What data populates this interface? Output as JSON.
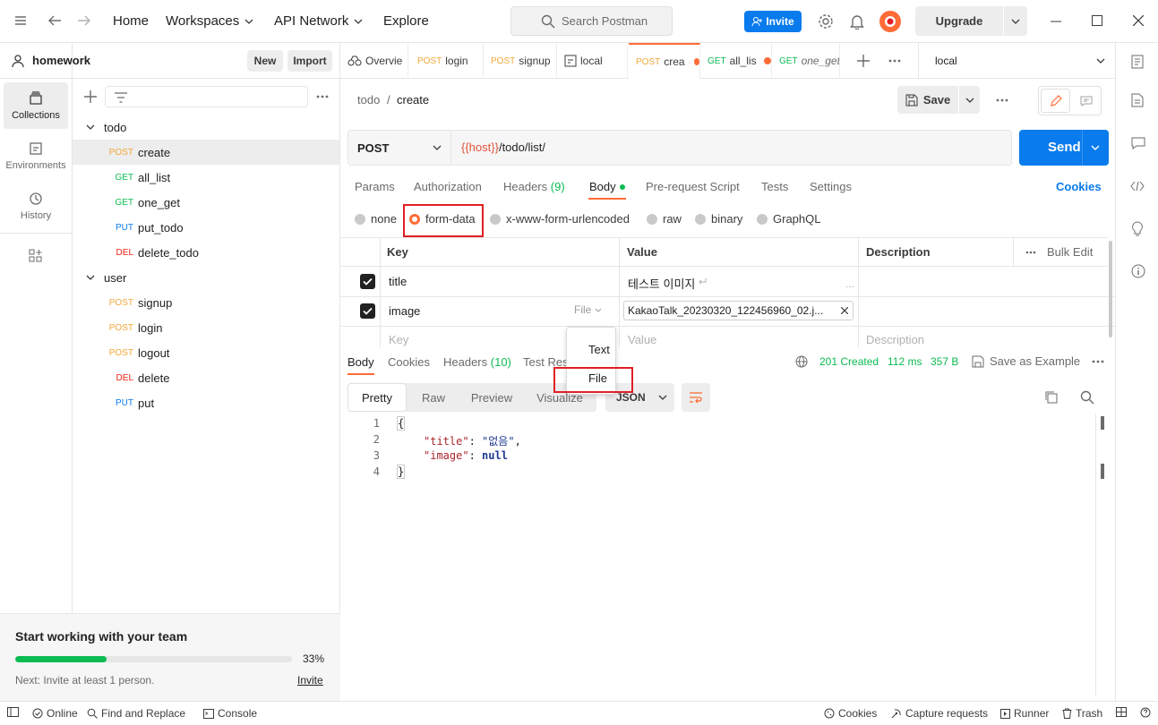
{
  "topbar": {
    "home": "Home",
    "workspaces": "Workspaces",
    "api_network": "API Network",
    "explore": "Explore",
    "search_placeholder": "Search Postman",
    "invite": "Invite",
    "upgrade": "Upgrade"
  },
  "workspace": {
    "name": "homework",
    "new": "New",
    "import": "Import"
  },
  "rail": {
    "collections": "Collections",
    "environments": "Environments",
    "history": "History"
  },
  "tree": {
    "todo": {
      "name": "todo",
      "items": [
        {
          "method": "POST",
          "name": "create"
        },
        {
          "method": "GET",
          "name": "all_list"
        },
        {
          "method": "GET",
          "name": "one_get"
        },
        {
          "method": "PUT",
          "name": "put_todo"
        },
        {
          "method": "DEL",
          "name": "delete_todo"
        }
      ]
    },
    "user": {
      "name": "user",
      "items": [
        {
          "method": "POST",
          "name": "signup"
        },
        {
          "method": "POST",
          "name": "login"
        },
        {
          "method": "POST",
          "name": "logout"
        },
        {
          "method": "DEL",
          "name": "delete"
        },
        {
          "method": "PUT",
          "name": "put"
        }
      ]
    }
  },
  "team_card": {
    "title": "Start working with your team",
    "percent": "33%",
    "progress": 0.33,
    "next": "Next: Invite at least 1 person.",
    "invite": "Invite"
  },
  "tabs": [
    {
      "method": "",
      "label": "Overvie"
    },
    {
      "method": "POST",
      "label": "login"
    },
    {
      "method": "POST",
      "label": "signup"
    },
    {
      "method": "",
      "label": "local"
    },
    {
      "method": "POST",
      "label": "crea"
    },
    {
      "method": "GET",
      "label": "all_lis"
    },
    {
      "method": "GET",
      "label": "one_get"
    }
  ],
  "environment": "local",
  "breadcrumb": {
    "parent": "todo",
    "sep": "/",
    "current": "create"
  },
  "save": "Save",
  "request": {
    "method": "POST",
    "url_var": "{{host}}",
    "url_path": "/todo/list/",
    "send": "Send"
  },
  "req_tabs": {
    "params": "Params",
    "authorization": "Authorization",
    "headers": "Headers",
    "headers_count": "(9)",
    "body": "Body",
    "pre_request": "Pre-request Script",
    "tests": "Tests",
    "settings": "Settings",
    "cookies": "Cookies"
  },
  "body_types": {
    "none": "none",
    "form_data": "form-data",
    "urlencoded": "x-www-form-urlencoded",
    "raw": "raw",
    "binary": "binary",
    "graphql": "GraphQL"
  },
  "table": {
    "key_header": "Key",
    "value_header": "Value",
    "desc_header": "Description",
    "bulk_edit": "Bulk Edit",
    "rows": [
      {
        "key": "title",
        "value": "테스트 이미지",
        "type": ""
      },
      {
        "key": "image",
        "value": "KakaoTalk_20230320_122456960_02.j...",
        "type": "File"
      }
    ],
    "placeholder_key": "Key",
    "placeholder_value": "Value",
    "placeholder_desc": "Description"
  },
  "type_menu": {
    "text": "Text",
    "file": "File"
  },
  "response": {
    "tabs": {
      "body": "Body",
      "cookies": "Cookies",
      "headers": "Headers",
      "headers_count": "(10)",
      "test_results": "Test Res"
    },
    "status": "201 Created",
    "time": "112 ms",
    "size": "357 B",
    "save_example": "Save as Example",
    "formats": {
      "pretty": "Pretty",
      "raw": "Raw",
      "preview": "Preview",
      "visualize": "Visualize"
    },
    "lang": "JSON",
    "code": {
      "l1": "{",
      "l2_key": "\"title\"",
      "l2_colon": ": ",
      "l2_val": "\"없음\"",
      "l2_comma": ",",
      "l3_key": "\"image\"",
      "l3_colon": ": ",
      "l3_val": "null",
      "l4": "}"
    }
  },
  "statusbar": {
    "online": "Online",
    "find_replace": "Find and Replace",
    "console": "Console",
    "cookies": "Cookies",
    "capture": "Capture requests",
    "runner": "Runner",
    "trash": "Trash"
  },
  "colors": {
    "accent": "#ff6c37",
    "primary": "#097bed",
    "success": "#0cbb52",
    "highlight": "#e01f26"
  }
}
